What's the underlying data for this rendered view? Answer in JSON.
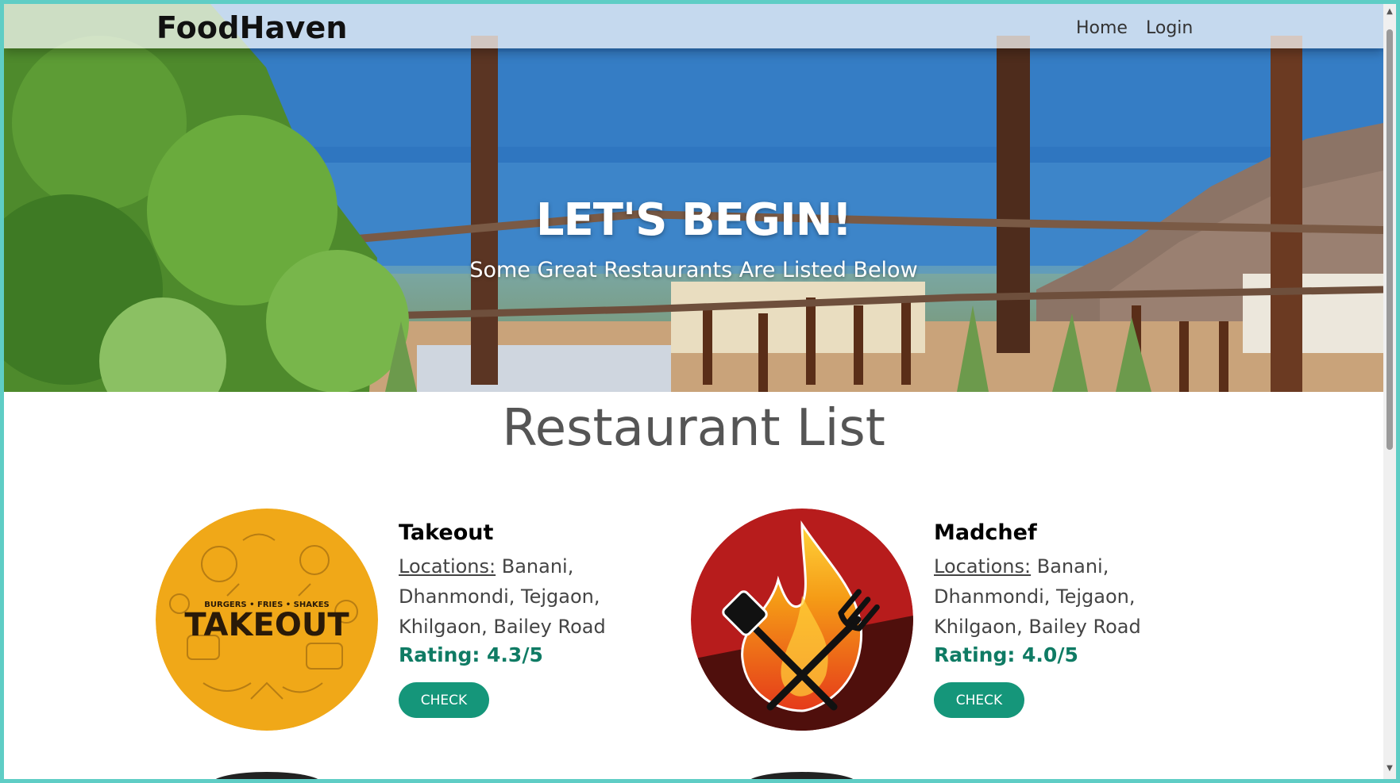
{
  "navbar": {
    "brand": "FoodHaven",
    "links": [
      {
        "label": "Home"
      },
      {
        "label": "Login"
      }
    ]
  },
  "hero": {
    "title": "LET'S BEGIN!",
    "subtitle": "Some Great Restaurants Are Listed Below"
  },
  "section": {
    "title": "Restaurant List"
  },
  "restaurants": [
    {
      "name": "Takeout",
      "locations_label": "Locations:",
      "locations": "Banani, Dhanmondi, Tejgaon, Khilgaon, Bailey Road",
      "rating": "Rating: 4.3/5",
      "button": "CHECK",
      "logo_text": "TAKEOUT",
      "logo_tagline": "BURGERS • FRIES • SHAKES",
      "logo_color": "#f0a818"
    },
    {
      "name": "Madchef",
      "locations_label": "Locations:",
      "locations": "Banani, Dhanmondi, Tejgaon, Khilgaon, Bailey Road",
      "rating": "Rating: 4.0/5",
      "button": "CHECK",
      "logo_color": "#b71c1c"
    }
  ],
  "colors": {
    "accent": "#15967a",
    "rating": "#0f7b64",
    "window_border": "#5fcdc5"
  }
}
